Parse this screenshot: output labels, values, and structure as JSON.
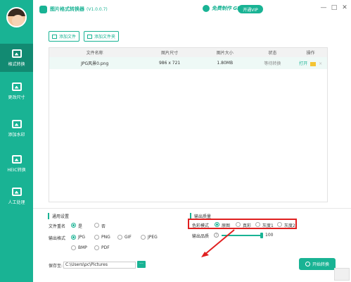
{
  "app": {
    "title": "图片格式转换器",
    "version": "(V1.0.0.7)"
  },
  "header": {
    "promo": "免费制作 GIF",
    "vip": "开通VIP",
    "min": "—",
    "max": "□",
    "close": "✕"
  },
  "sidebar": {
    "items": [
      {
        "label": "格式转换"
      },
      {
        "label": "更改尺寸"
      },
      {
        "label": "添加水印"
      },
      {
        "label": "HEIC转换"
      },
      {
        "label": "人工处理"
      }
    ]
  },
  "toolbar": {
    "add_file": "添加文件",
    "add_folder": "添加文件夹"
  },
  "table": {
    "headers": [
      "文件名称",
      "图片尺寸",
      "图片大小",
      "状态",
      "操作"
    ],
    "rows": [
      {
        "name": "JPG风景0.png",
        "size": "986 x 721",
        "filesize": "1.80MB",
        "status": "等待转换",
        "open": "打开",
        "delete": "×"
      }
    ]
  },
  "settings": {
    "general_title": "通用设置",
    "rename_label": "文件重名",
    "rename_yes": "是",
    "rename_no": "否",
    "format_label": "输出格式",
    "formats": [
      "JPG",
      "PNG",
      "GIF",
      "JPEG",
      "BMP",
      "PDF"
    ],
    "selected_format": "JPG",
    "quality_title": "输出质量",
    "color_mode_label": "色彩模式",
    "color_modes": [
      "原图",
      "真彩",
      "灰度1",
      "灰度2"
    ],
    "selected_color_mode": "原图",
    "quality_label": "输出品质",
    "quality_help": "?",
    "quality_value": "100"
  },
  "footer": {
    "save_to_label": "保存至:",
    "save_path": "C:\\Users\\pc\\Pictures",
    "browse": "···",
    "start": "开始转换"
  },
  "colors": {
    "accent": "#19b394",
    "highlight_box": "#e02020"
  }
}
